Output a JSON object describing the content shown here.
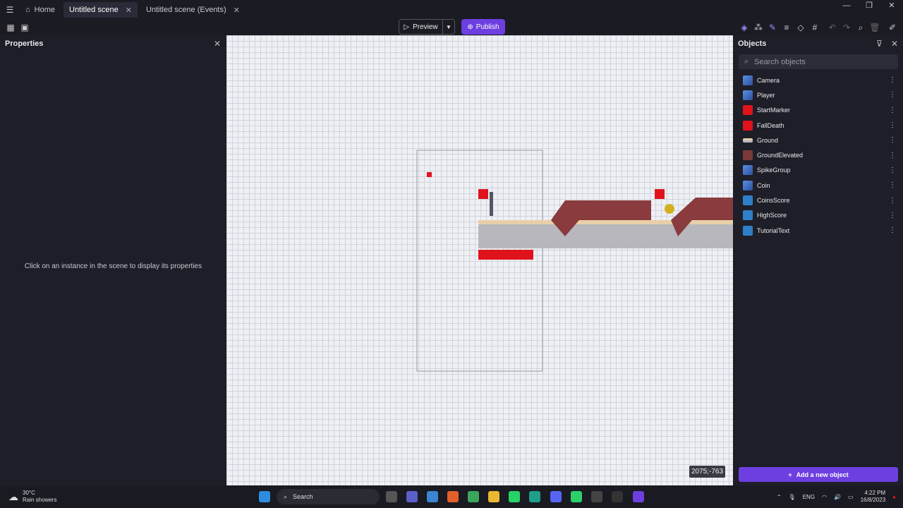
{
  "tabs": [
    {
      "label": "Home"
    },
    {
      "label": "Untitled scene"
    },
    {
      "label": "Untitled scene (Events)"
    }
  ],
  "toolbar": {
    "preview_label": "Preview",
    "publish_label": "Publish"
  },
  "properties": {
    "title": "Properties",
    "empty_message": "Click on an instance in the scene to display its properties"
  },
  "canvas": {
    "coords": "2075;-763"
  },
  "objects": {
    "title": "Objects",
    "search_placeholder": "Search objects",
    "items": [
      {
        "label": "Camera",
        "icon": "cube-icon"
      },
      {
        "label": "Player",
        "icon": "cube-icon"
      },
      {
        "label": "StartMarker",
        "icon": "red-sprite-icon"
      },
      {
        "label": "FallDeath",
        "icon": "red-sprite-icon"
      },
      {
        "label": "Ground",
        "icon": "ground-sprite-icon"
      },
      {
        "label": "GroundElevated",
        "icon": "brown-sprite-icon"
      },
      {
        "label": "SpikeGroup",
        "icon": "cube-icon"
      },
      {
        "label": "Coin",
        "icon": "cube-icon"
      },
      {
        "label": "CoinsScore",
        "icon": "text-object-icon"
      },
      {
        "label": "HighScore",
        "icon": "text-object-icon"
      },
      {
        "label": "TutorialText",
        "icon": "text-object-icon"
      }
    ],
    "add_label": "Add a new object"
  },
  "taskbar": {
    "temp": "30°C",
    "weather": "Rain showers",
    "search": "Search",
    "lang": "ENG",
    "time": "4:22 PM",
    "date": "16/8/2023"
  },
  "colors": {
    "accent": "#6d3fe0",
    "red_sprite": "#e0131d"
  }
}
